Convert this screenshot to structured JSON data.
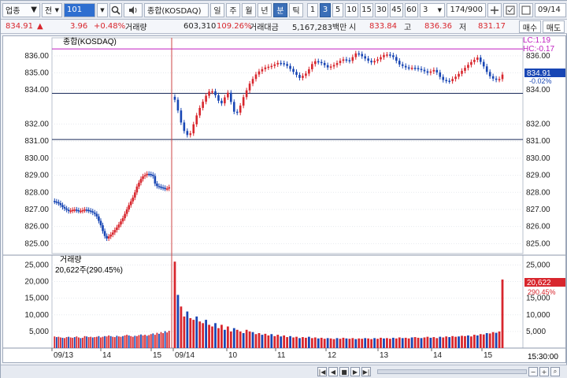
{
  "toolbar": {
    "market_select": "업종",
    "mode_label": "전",
    "code_value": "101",
    "period_buttons": [
      "일",
      "주",
      "월",
      "년",
      "분",
      "틱"
    ],
    "interval_buttons": [
      "1",
      "3",
      "5",
      "10",
      "15",
      "30",
      "45",
      "60"
    ],
    "active_period": "분",
    "active_interval": "3",
    "interval_input": "3",
    "count_input": "174/900",
    "date_input": "09/14",
    "security_name": "종합(KOSDAQ)"
  },
  "quote": {
    "price": "834.91",
    "change": "3.96",
    "change_rate": "+0.48%",
    "volume_label": "거래량",
    "volume": "603,310",
    "volume_rate": "109.26%",
    "amount_label": "거래대금",
    "amount": "5,167,283백만",
    "open_label": "시",
    "open": "833.84",
    "high_label": "고",
    "high": "836.36",
    "low_label": "저",
    "low": "831.17",
    "buy_label": "매수",
    "sell_label": "매도"
  },
  "price_pane": {
    "title": "종합(KOSDAQ)",
    "lc": "LC:1.19",
    "hc": "HC:-0.17",
    "current": "834.91",
    "current_change": "-0.02%"
  },
  "volume_pane": {
    "title": "거래량",
    "info": "20,622주(290.45%)",
    "current": "20,622",
    "current_rate": "290.45%"
  },
  "time_end_label": "15:30:00",
  "colors": {
    "up": "#d8262d",
    "down": "#1846b4"
  },
  "chart_data": {
    "type": "candlestick",
    "price_axis": {
      "ticks": [
        "836.00",
        "835.00",
        "834.00",
        "832.00",
        "831.00",
        "830.00",
        "829.00",
        "828.00",
        "827.00",
        "826.00",
        "825.00"
      ],
      "range": [
        824.6,
        836.5
      ]
    },
    "volume_axis": {
      "ticks_left": [
        "25,000",
        "20,000",
        "15,000",
        "10,000",
        "5,000"
      ],
      "ticks_right": [
        "25,000",
        "20,000",
        "15,000",
        "10,000",
        "5,000"
      ],
      "range": [
        0,
        27000
      ]
    },
    "x_labels": [
      "09/13",
      "14",
      "15",
      "09/14",
      "10",
      "11",
      "12",
      "13",
      "14",
      "15"
    ],
    "hlines": [
      833.8,
      831.1
    ],
    "ref_lines": [
      836.4
    ],
    "day1_close_points": [
      [
        0,
        827.5
      ],
      [
        4,
        827.4
      ],
      [
        8,
        827.1
      ],
      [
        12,
        826.9
      ],
      [
        16,
        827.0
      ],
      [
        20,
        826.9
      ],
      [
        24,
        827.0
      ],
      [
        28,
        826.9
      ],
      [
        32,
        826.7
      ],
      [
        36,
        826.0
      ],
      [
        38,
        825.5
      ],
      [
        40,
        825.3
      ],
      [
        44,
        825.6
      ],
      [
        48,
        826.0
      ],
      [
        52,
        826.5
      ],
      [
        56,
        827.2
      ],
      [
        60,
        827.8
      ],
      [
        62,
        828.3
      ],
      [
        64,
        828.6
      ],
      [
        66,
        828.9
      ],
      [
        70,
        829.1
      ],
      [
        74,
        829.0
      ],
      [
        76,
        828.4
      ],
      [
        80,
        828.3
      ],
      [
        84,
        828.2
      ],
      [
        86,
        828.3
      ]
    ],
    "day2_close_points": [
      [
        0,
        833.6
      ],
      [
        2,
        833.4
      ],
      [
        4,
        832.6
      ],
      [
        6,
        831.8
      ],
      [
        8,
        831.4
      ],
      [
        10,
        831.3
      ],
      [
        12,
        831.9
      ],
      [
        14,
        832.5
      ],
      [
        16,
        833.0
      ],
      [
        18,
        833.4
      ],
      [
        20,
        833.8
      ],
      [
        22,
        834.0
      ],
      [
        24,
        833.8
      ],
      [
        26,
        833.4
      ],
      [
        28,
        833.2
      ],
      [
        30,
        833.6
      ],
      [
        32,
        833.9
      ],
      [
        34,
        833.0
      ],
      [
        36,
        832.5
      ],
      [
        38,
        832.9
      ],
      [
        40,
        833.5
      ],
      [
        44,
        834.4
      ],
      [
        48,
        835.0
      ],
      [
        52,
        835.3
      ],
      [
        56,
        835.4
      ],
      [
        60,
        835.6
      ],
      [
        64,
        835.5
      ],
      [
        68,
        835.1
      ],
      [
        72,
        834.7
      ],
      [
        76,
        835.0
      ],
      [
        80,
        835.7
      ],
      [
        84,
        835.6
      ],
      [
        88,
        835.3
      ],
      [
        92,
        835.5
      ],
      [
        96,
        835.8
      ],
      [
        100,
        835.7
      ],
      [
        104,
        836.2
      ],
      [
        108,
        835.9
      ],
      [
        112,
        835.6
      ],
      [
        116,
        835.8
      ],
      [
        120,
        836.1
      ],
      [
        124,
        836.0
      ],
      [
        128,
        835.5
      ],
      [
        132,
        835.3
      ],
      [
        136,
        835.3
      ],
      [
        140,
        835.2
      ],
      [
        144,
        835.0
      ],
      [
        148,
        835.2
      ],
      [
        152,
        834.6
      ],
      [
        156,
        834.5
      ],
      [
        160,
        834.8
      ],
      [
        164,
        835.2
      ],
      [
        168,
        835.6
      ],
      [
        172,
        835.9
      ],
      [
        174,
        835.6
      ],
      [
        176,
        835.3
      ],
      [
        178,
        834.9
      ],
      [
        180,
        834.7
      ],
      [
        182,
        834.6
      ],
      [
        184,
        834.6
      ],
      [
        186,
        834.9
      ]
    ],
    "volume_day1": [
      3500,
      3300,
      3400,
      3200,
      3100,
      3000,
      3300,
      3400,
      3200,
      3100,
      3300,
      3500,
      3200,
      3000,
      3100,
      3600,
      3500,
      3300,
      3400,
      3200,
      3300,
      3400,
      3600,
      3200,
      3400,
      3600,
      3500,
      3800,
      3600,
      3400,
      3300,
      3700,
      3500,
      3400,
      3600,
      3800,
      4000,
      3800,
      3600,
      3400,
      3700,
      3600,
      3900,
      4100,
      3800,
      4000,
      3700,
      3900,
      4200,
      4400,
      4000,
      4600,
      4300,
      4800,
      4500,
      5100,
      4700,
      5200
    ],
    "volume_day2": [
      26000,
      16000,
      12500,
      9500,
      11000,
      9000,
      8500,
      9500,
      8000,
      7500,
      8500,
      7000,
      6500,
      7500,
      6000,
      7000,
      5500,
      6500,
      5000,
      6000,
      5500,
      5000,
      4500,
      5500,
      5000,
      4800,
      4200,
      4500,
      4000,
      4300,
      3800,
      4200,
      3600,
      4000,
      3500,
      3800,
      3300,
      3600,
      3200,
      3400,
      3000,
      3300,
      3100,
      3400,
      3000,
      3200,
      2900,
      3100,
      2800,
      3000,
      2900,
      2700,
      3000,
      2800,
      3100,
      2900,
      2800,
      3000,
      2700,
      2900,
      2800,
      3000,
      2900,
      2700,
      3000,
      2800,
      3100,
      2900,
      3000,
      2800,
      3100,
      2900,
      3200,
      3000,
      3100,
      2900,
      3200,
      3300,
      3100,
      3000,
      3200,
      3400,
      3100,
      3300,
      3000,
      3400,
      3200,
      3500,
      3300,
      3600,
      3400,
      3500,
      3700,
      3600,
      3800,
      3500,
      4000,
      3800,
      4200,
      4100,
      4500,
      4400,
      4800,
      4600,
      5000,
      20622
    ]
  }
}
